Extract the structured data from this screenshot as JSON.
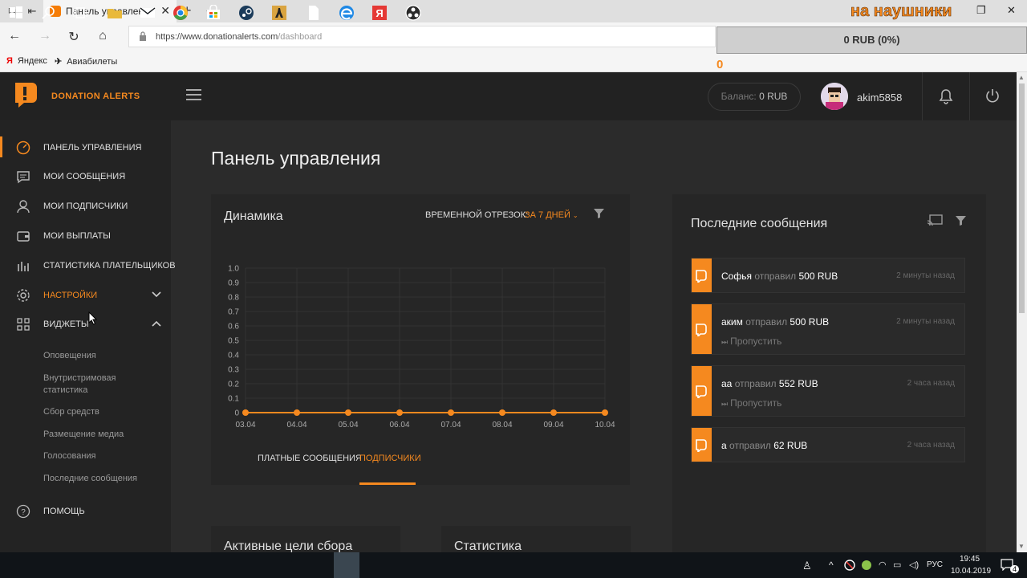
{
  "browser": {
    "tab_title": "Панель управления - Г",
    "url_host": "https://www.donationalerts.com",
    "url_path": "/dashboard",
    "bookmarks": [
      "Яндекс",
      "Авиабилеты"
    ]
  },
  "overlay": {
    "caption": "на наушники",
    "goal_label": "0 RUB (0%)",
    "goal_progress": 0,
    "counter": "0"
  },
  "app": {
    "brand": "DONATION ALERTS",
    "balance_label": "Баланс:",
    "balance_value": "0 RUB",
    "username": "akim5858"
  },
  "sidebar": {
    "items": [
      {
        "label": "Панель управления",
        "icon": "dashboard-icon"
      },
      {
        "label": "Мои сообщения",
        "icon": "message-icon"
      },
      {
        "label": "Мои подписчики",
        "icon": "user-icon"
      },
      {
        "label": "Мои выплаты",
        "icon": "wallet-icon"
      },
      {
        "label": "Статистика плательщиков",
        "icon": "stats-icon"
      },
      {
        "label": "Настройки",
        "icon": "gear-icon"
      },
      {
        "label": "Виджеты",
        "icon": "widgets-icon"
      }
    ],
    "widgets_sub": [
      "Оповещения",
      "Внутристримовая статистика",
      "Сбор средств",
      "Размещение медиа",
      "Голосования",
      "Последние сообщения"
    ],
    "help": "Помощь"
  },
  "main": {
    "title": "Панель управления",
    "dynamics": {
      "title": "Динамика",
      "period_label": "Временной отрезок:",
      "period_value": "За 7 дней",
      "tabs": [
        "Платные сообщения",
        "Подписчики"
      ],
      "active_tab": 1
    },
    "recent": {
      "title": "Последние сообщения",
      "skip_label": "Пропустить",
      "messages": [
        {
          "name": "Софья",
          "verb": "отправил",
          "amount": "500 RUB",
          "time": "2 минуты назад"
        },
        {
          "name": "аким",
          "verb": "отправил",
          "amount": "500 RUB",
          "time": "2 минуты назад"
        },
        {
          "name": "аа",
          "verb": "отправил",
          "amount": "552 RUB",
          "time": "2 часа назад"
        },
        {
          "name": "а",
          "verb": "отправил",
          "amount": "62 RUB",
          "time": "2 часа назад"
        }
      ]
    },
    "bottom_cards": [
      "Активные цели сбора",
      "Статистика"
    ]
  },
  "chart_data": {
    "type": "line",
    "categories": [
      "03.04",
      "04.04",
      "05.04",
      "06.04",
      "07.04",
      "08.04",
      "09.04",
      "10.04"
    ],
    "values": [
      0,
      0,
      0,
      0,
      0,
      0,
      0,
      0
    ],
    "ylim": [
      0,
      1.0
    ],
    "yticks": [
      "0",
      "0.1",
      "0.2",
      "0.3",
      "0.4",
      "0.5",
      "0.6",
      "0.7",
      "0.8",
      "0.9",
      "1.0"
    ],
    "grid": true,
    "color": "#f5891f"
  },
  "taskbar": {
    "lang": "РУС",
    "time": "19:45",
    "date": "10.04.2019",
    "notifications": "4"
  },
  "colors": {
    "accent": "#f5891f",
    "sidebar_bg": "#232323",
    "page_bg": "#2b2b2b"
  }
}
